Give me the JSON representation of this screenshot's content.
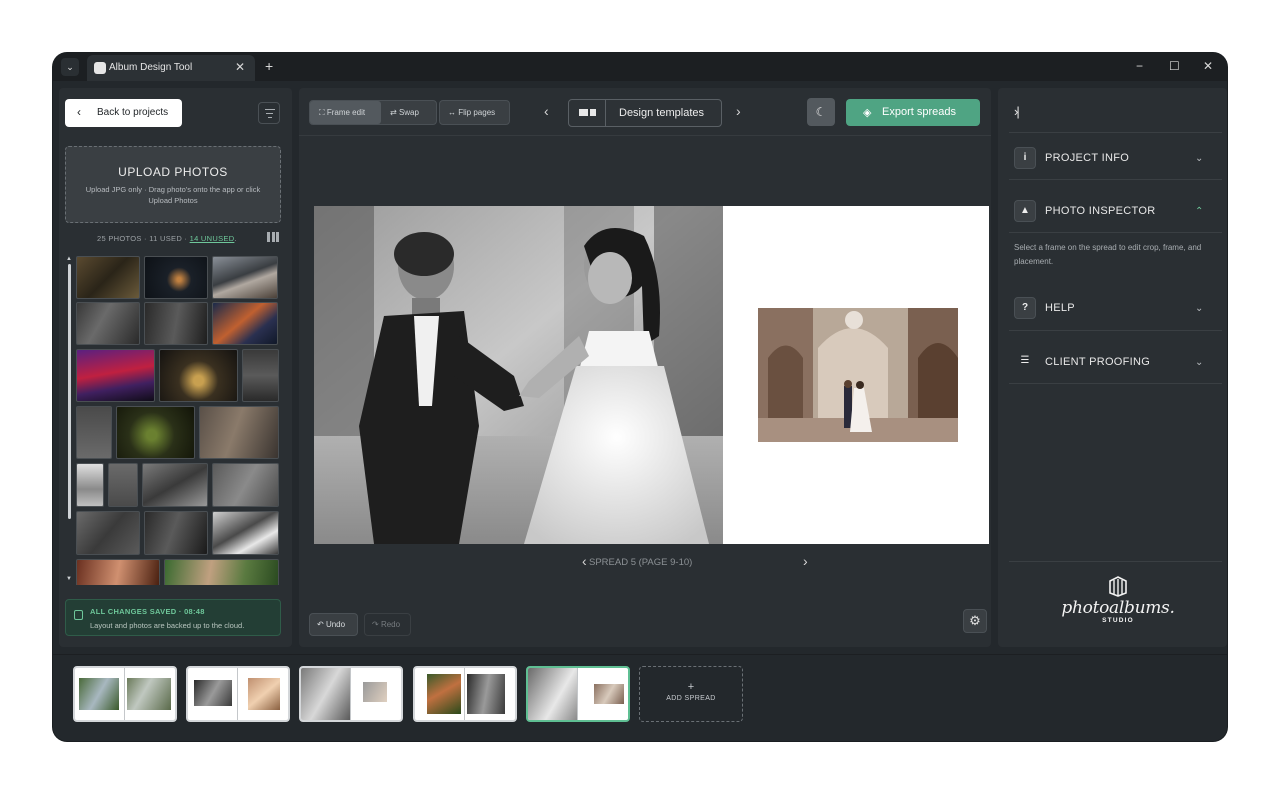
{
  "window": {
    "tab_title": "Album Design Tool",
    "controls": {
      "minimize": "−",
      "maximize": "☐",
      "close": "✕"
    }
  },
  "left_panel": {
    "back_label": "Back to projects",
    "upload": {
      "title": "UPLOAD PHOTOS",
      "description": "Upload JPG only · Drag photo's onto the app or click Upload Photos"
    },
    "photos_meta": {
      "prefix": "25 PHOTOS · 11 USED · ",
      "unused": "14 UNUSED",
      "suffix": "."
    },
    "saved": {
      "title": "ALL CHANGES SAVED · 08:48",
      "description": "Layout and photos are backed up to the cloud."
    }
  },
  "toolbar": {
    "frame_edit": "Frame edit",
    "swap": "Swap",
    "flip_pages": "Flip pages",
    "design_templates": "Design templates",
    "export": "Export spreads"
  },
  "canvas": {
    "spread_label": "SPREAD 5 (PAGE 9-10)",
    "undo": "Undo",
    "redo": "Redo"
  },
  "right_panel": {
    "sections": [
      {
        "icon": "i",
        "title": "PROJECT INFO",
        "expanded": false
      },
      {
        "icon": "▲",
        "title": "PHOTO INSPECTOR",
        "expanded": true
      },
      {
        "icon": "?",
        "title": "HELP",
        "expanded": false
      },
      {
        "icon": "☰",
        "title": "CLIENT PROOFING",
        "expanded": false
      }
    ],
    "inspector_desc": "Select a frame on the spread to edit crop, frame, and placement.",
    "logo": {
      "script": "photoalbums.",
      "sub": "STUDIO"
    }
  },
  "filmstrip": {
    "add_spread_label": "ADD SPREAD",
    "active_index": 4
  },
  "colors": {
    "accent": "#4fa483",
    "accent_text": "#6ec79a",
    "panel": "#2a2f33",
    "window": "#23282c"
  }
}
